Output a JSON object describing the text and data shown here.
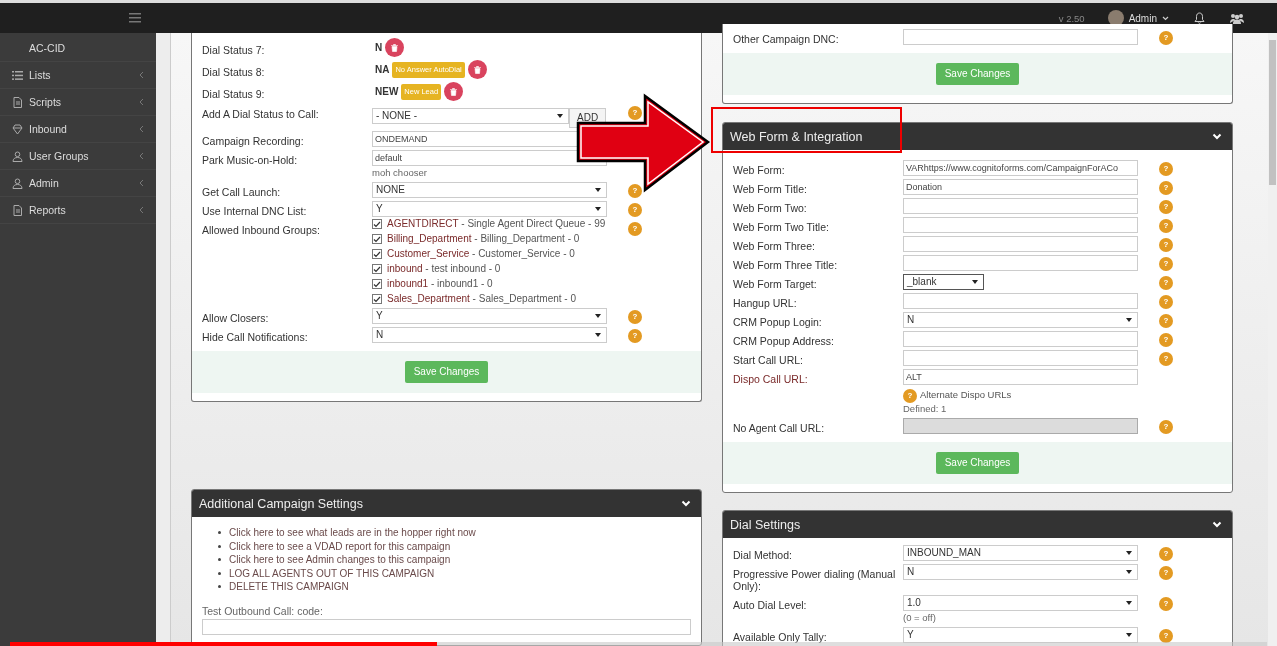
{
  "topbar": {
    "version": "v 2.50",
    "user": "Admin"
  },
  "sidebar": {
    "items": [
      {
        "label": "AC-CID",
        "kind": "subitem"
      },
      {
        "label": "Lists",
        "kind": "item"
      },
      {
        "label": "Scripts",
        "kind": "item"
      },
      {
        "label": "Inbound",
        "kind": "item"
      },
      {
        "label": "User Groups",
        "kind": "item"
      },
      {
        "label": "Admin",
        "kind": "item"
      },
      {
        "label": "Reports",
        "kind": "item"
      }
    ]
  },
  "columns": [
    {
      "panels": [
        {
          "rows": [
            {
              "kind": "status",
              "label": "Dial Status 7:",
              "code": "N"
            },
            {
              "kind": "status",
              "label": "Dial Status 8:",
              "code": "NA",
              "badge": "No Answer AutoDial"
            },
            {
              "kind": "status",
              "label": "Dial Status 9:",
              "code": "NEW",
              "badge": "New Lead"
            },
            {
              "kind": "select",
              "label": "Add A Dial Status to Call:",
              "value": "- NONE -",
              "button": "ADD",
              "help": "?"
            },
            {
              "kind": "input",
              "label": "Campaign Recording:",
              "value": "ONDEMAND"
            },
            {
              "kind": "input",
              "label": "Park Music-on-Hold:",
              "value": "default",
              "note": "moh chooser"
            },
            {
              "kind": "select",
              "label": "Get Call Launch:",
              "value": "NONE",
              "help": "?"
            },
            {
              "kind": "select",
              "label": "Use Internal DNC List:",
              "value": "Y",
              "help": "?"
            },
            {
              "kind": "checklist",
              "label": "Allowed Inbound Groups:",
              "help": "?",
              "items": [
                {
                  "name": "AGENTDIRECT",
                  "detail": "- Single Agent Direct Queue - 99",
                  "checked": true
                },
                {
                  "name": "Billing_Department",
                  "detail": "- Billing_Department - 0",
                  "checked": true
                },
                {
                  "name": "Customer_Service",
                  "detail": "- Customer_Service - 0",
                  "checked": true
                },
                {
                  "name": "inbound",
                  "detail": "- test inbound - 0",
                  "checked": true
                },
                {
                  "name": "inbound1",
                  "detail": "- inbound1 - 0",
                  "checked": true
                },
                {
                  "name": "Sales_Department",
                  "detail": "- Sales_Department - 0",
                  "checked": true
                }
              ]
            },
            {
              "kind": "select",
              "label": "Allow Closers:",
              "value": "Y",
              "help": "?"
            },
            {
              "kind": "select",
              "label": "Hide Call Notifications:",
              "value": "N",
              "help": "?"
            }
          ],
          "save_button": "Save Changes"
        },
        {
          "title": "Additional Campaign Settings",
          "links": [
            "Click here to see what leads are in the hopper right now",
            "Click here to see a VDAD report for this campaign",
            "Click here to see Admin changes to this campaign",
            "LOG ALL AGENTS OUT OF THIS CAMPAIGN",
            "DELETE THIS CAMPAIGN"
          ],
          "rows": [
            {
              "kind": "stacked_input",
              "label": "Test Outbound Call: code:"
            }
          ]
        }
      ]
    },
    {
      "panels": [
        {
          "rows": [
            {
              "kind": "input",
              "label": "Other Campaign DNC:",
              "help": "?"
            }
          ],
          "save_button": "Save Changes"
        },
        {
          "title": "Web Form & Integration",
          "rows": [
            {
              "kind": "input",
              "label": "Web Form:",
              "value": "VARhttps://www.cognitoforms.com/CampaignForACo",
              "help": "?",
              "disabled": false
            },
            {
              "kind": "input",
              "label": "Web Form Title:",
              "value": "Donation",
              "help": "?",
              "disabled": false
            },
            {
              "kind": "input",
              "label": "Web Form Two:",
              "help": "?",
              "disabled": false
            },
            {
              "kind": "input",
              "label": "Web Form Two Title:",
              "help": "?",
              "disabled": false
            },
            {
              "kind": "input",
              "label": "Web Form Three:",
              "help": "?",
              "disabled": false
            },
            {
              "kind": "input",
              "label": "Web Form Three Title:",
              "help": "?",
              "disabled": false
            },
            {
              "kind": "small_select",
              "label": "Web Form Target:",
              "value": "_blank",
              "help": "?"
            },
            {
              "kind": "input",
              "label": "Hangup URL:",
              "help": "?",
              "disabled": false
            },
            {
              "kind": "select",
              "label": "CRM Popup Login:",
              "value": "N",
              "help": "?"
            },
            {
              "kind": "input",
              "label": "CRM Popup Address:",
              "help": "?",
              "disabled": false
            },
            {
              "kind": "input",
              "label": "Start Call URL:",
              "help": "?",
              "disabled": false
            },
            {
              "kind": "dispo",
              "label": "Dispo Call URL:",
              "value": "ALT",
              "link_icon": "?",
              "link": "Alternate Dispo URLs",
              "note": "Defined: 1"
            },
            {
              "kind": "input",
              "label": "No Agent Call URL:",
              "help": "?",
              "disabled": true
            }
          ],
          "save_button": "Save Changes"
        },
        {
          "title": "Dial Settings",
          "rows": [
            {
              "kind": "select",
              "label": "Dial Method:",
              "value": "INBOUND_MAN",
              "help": "?"
            },
            {
              "kind": "select",
              "label": "Progressive Power dialing (Manual Only):",
              "value": "N",
              "help": "?"
            },
            {
              "kind": "select",
              "label": "Auto Dial Level:",
              "value": "1.0",
              "note": "(0 = off)",
              "help": "?"
            },
            {
              "kind": "select",
              "label": "Available Only Tally:",
              "value": "Y",
              "help": "?"
            }
          ]
        }
      ]
    }
  ],
  "video_progress": {
    "level": 0.34
  }
}
